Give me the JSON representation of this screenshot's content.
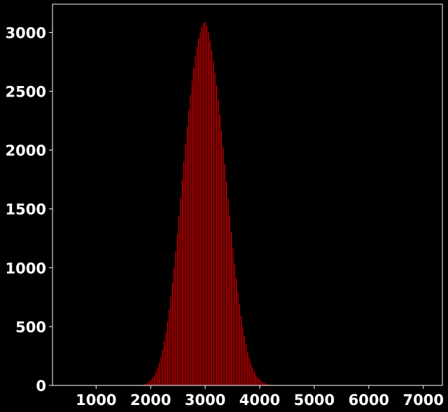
{
  "chart_data": {
    "type": "bar",
    "title": "",
    "xlabel": "",
    "ylabel": "",
    "xlim": [
      200,
      7350
    ],
    "ylim": [
      0,
      3240
    ],
    "x_ticks": [
      1000,
      2000,
      3000,
      4000,
      5000,
      6000,
      7000
    ],
    "y_ticks": [
      0,
      500,
      1000,
      1500,
      2000,
      2500,
      3000
    ],
    "x_tick_labels": [
      "1000",
      "2000",
      "3000",
      "4000",
      "5000",
      "6000",
      "7000"
    ],
    "y_tick_labels": [
      "0",
      "500",
      "1000",
      "1500",
      "2000",
      "2500",
      "3000"
    ],
    "grid": false,
    "legend": false,
    "bar_width": 20,
    "colors": {
      "background": "#000000",
      "bar": "#ff0000",
      "bar_edge": "#000000",
      "axes": "#ffffff",
      "text": "#ffffff"
    },
    "series": [
      {
        "x": [
          1800,
          1830,
          1860,
          1890,
          1920,
          1950,
          1980,
          2010,
          2040,
          2070,
          2100,
          2130,
          2160,
          2190,
          2220,
          2250,
          2280,
          2310,
          2340,
          2370,
          2400,
          2430,
          2460,
          2490,
          2520,
          2550,
          2580,
          2610,
          2640,
          2670,
          2700,
          2730,
          2760,
          2790,
          2820,
          2850,
          2880,
          2910,
          2940,
          2970,
          3000,
          3030,
          3060,
          3090,
          3120,
          3150,
          3180,
          3210,
          3240,
          3270,
          3300,
          3330,
          3360,
          3390,
          3420,
          3450,
          3480,
          3510,
          3540,
          3570,
          3600,
          3630,
          3660,
          3690,
          3720,
          3750,
          3780,
          3810,
          3840,
          3870,
          3900,
          3930,
          3960,
          3990,
          4020,
          4050,
          4080,
          4110,
          4140,
          4170,
          4200,
          4230,
          4260,
          4290
        ],
        "values": [
          3,
          5,
          8,
          12,
          18,
          26,
          36,
          50,
          68,
          90,
          118,
          152,
          195,
          245,
          305,
          375,
          455,
          545,
          645,
          755,
          875,
          1005,
          1145,
          1290,
          1440,
          1595,
          1750,
          1905,
          2055,
          2200,
          2340,
          2470,
          2590,
          2700,
          2800,
          2880,
          2950,
          3000,
          3050,
          3080,
          3090,
          3060,
          3000,
          2930,
          2850,
          2760,
          2660,
          2550,
          2430,
          2300,
          2165,
          2025,
          1880,
          1735,
          1590,
          1445,
          1305,
          1170,
          1040,
          915,
          800,
          690,
          590,
          500,
          420,
          350,
          288,
          235,
          190,
          152,
          120,
          94,
          73,
          56,
          42,
          31,
          23,
          17,
          12,
          8,
          6,
          4,
          3,
          2
        ]
      }
    ]
  }
}
